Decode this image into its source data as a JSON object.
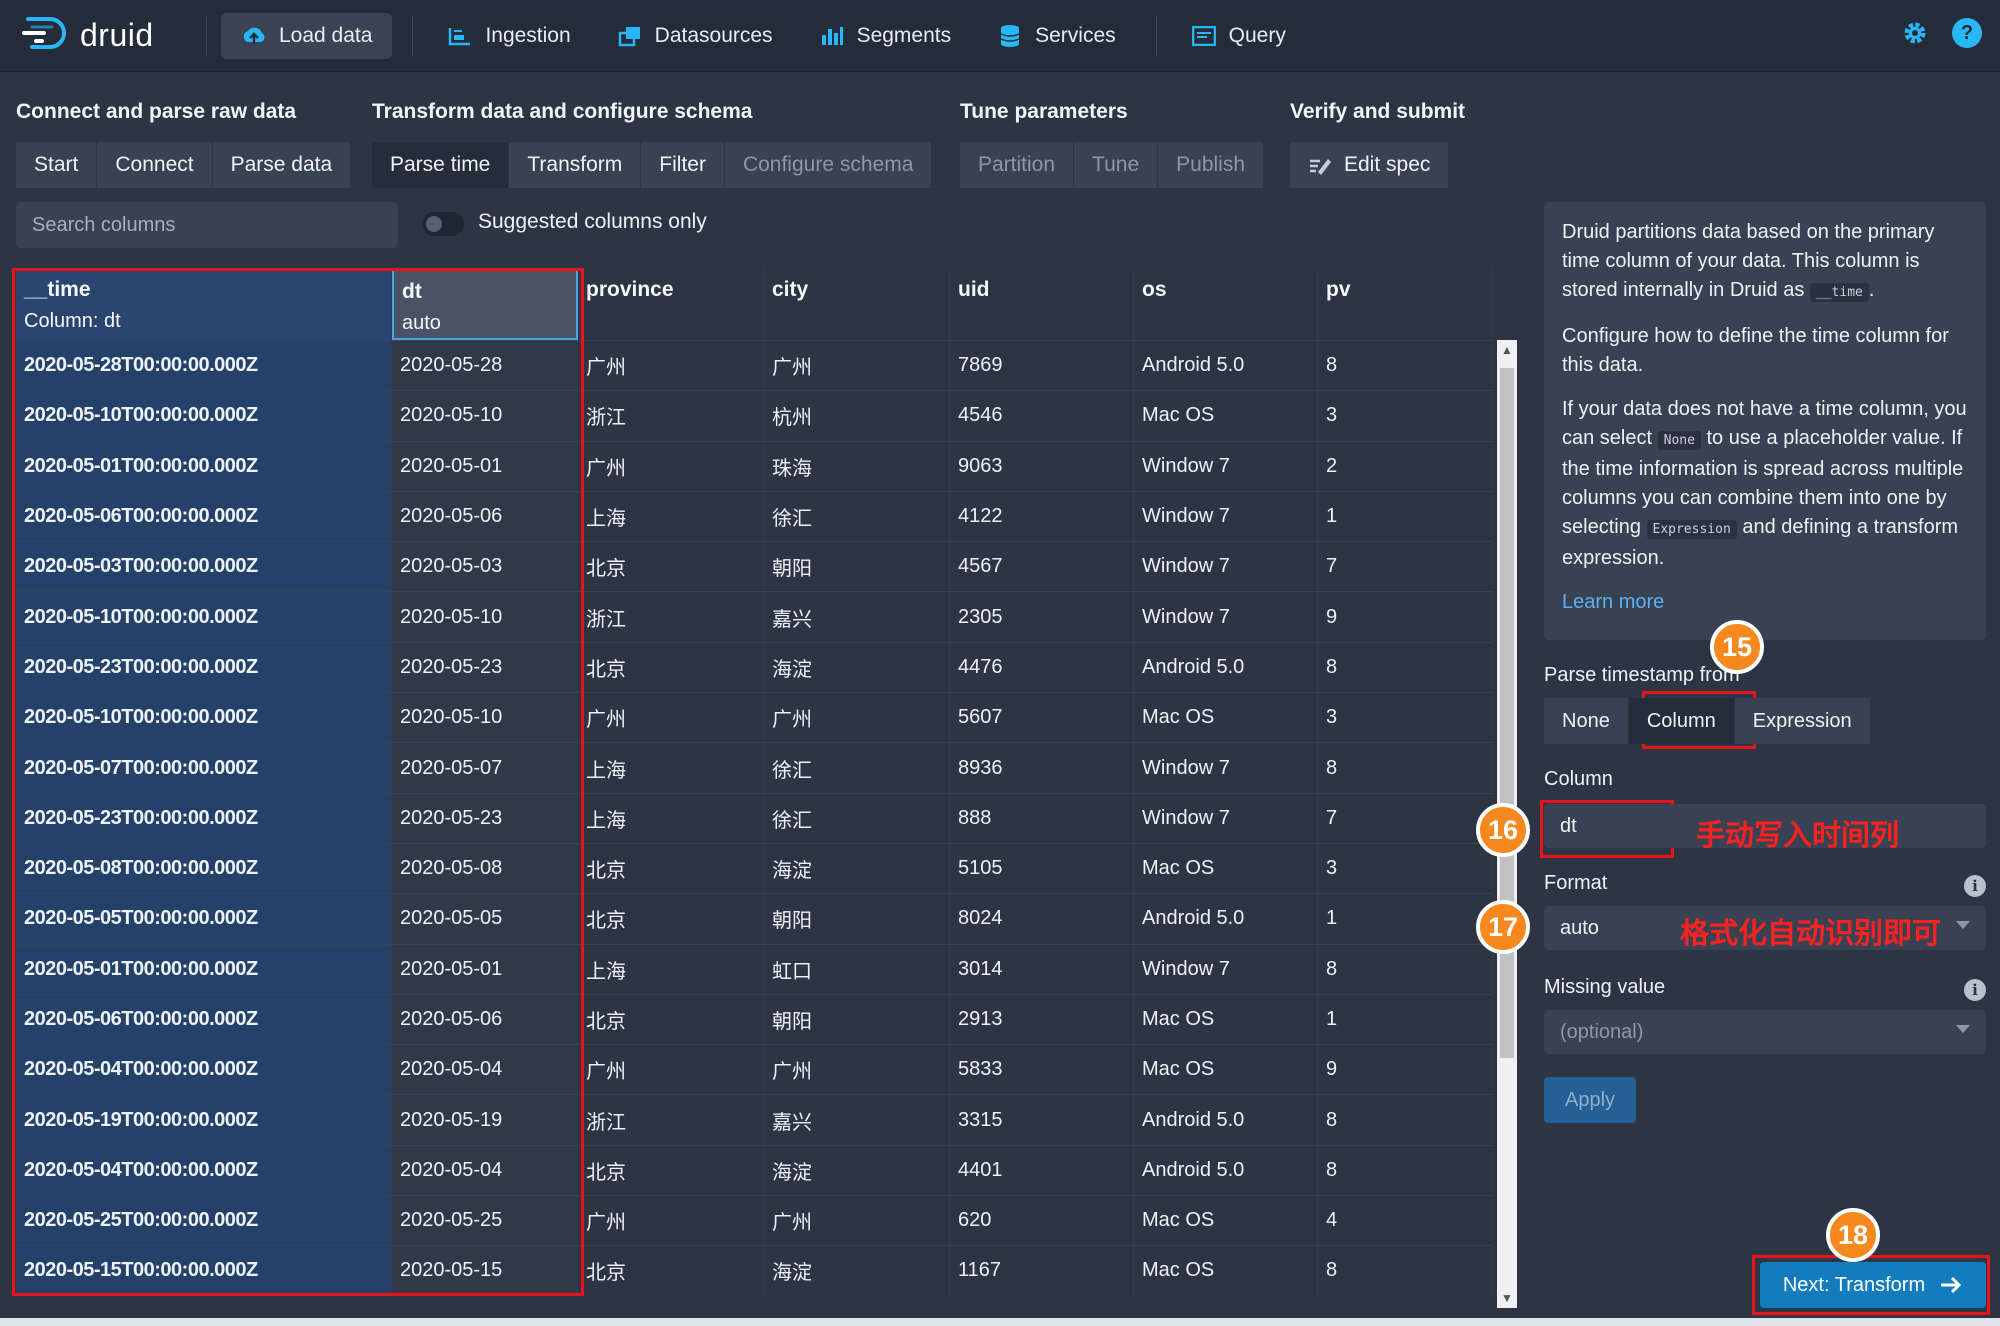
{
  "nav": {
    "logo": "druid",
    "items": [
      {
        "label": "Load data",
        "icon": "cloud-upload-icon",
        "active": true
      },
      {
        "label": "Ingestion",
        "icon": "ingestion-icon"
      },
      {
        "label": "Datasources",
        "icon": "datasources-icon"
      },
      {
        "label": "Segments",
        "icon": "segments-icon"
      },
      {
        "label": "Services",
        "icon": "database-icon"
      },
      {
        "label": "Query",
        "icon": "console-icon"
      }
    ],
    "right_icons": [
      "gear-icon",
      "help-icon"
    ]
  },
  "steps": {
    "groups": [
      {
        "title": "Connect and parse raw data",
        "buttons": [
          "Start",
          "Connect",
          "Parse data"
        ]
      },
      {
        "title": "Transform data and configure schema",
        "buttons": [
          "Parse time",
          "Transform",
          "Filter",
          "Configure schema"
        ]
      },
      {
        "title": "Tune parameters",
        "buttons": [
          "Partition",
          "Tune",
          "Publish"
        ]
      },
      {
        "title": "Verify and submit",
        "buttons": [
          "Edit spec"
        ]
      }
    ],
    "active": "Parse time"
  },
  "search": {
    "placeholder": "Search columns",
    "toggle_label": "Suggested columns only"
  },
  "table": {
    "columns": [
      {
        "name": "__time",
        "sub": "Column: dt"
      },
      {
        "name": "dt",
        "sub": "auto"
      },
      {
        "name": "province",
        "sub": ""
      },
      {
        "name": "city",
        "sub": ""
      },
      {
        "name": "uid",
        "sub": ""
      },
      {
        "name": "os",
        "sub": ""
      },
      {
        "name": "pv",
        "sub": ""
      }
    ],
    "rows": [
      [
        "2020-05-28T00:00:00.000Z",
        "2020-05-28",
        "广州",
        "广州",
        "7869",
        "Android 5.0",
        "8"
      ],
      [
        "2020-05-10T00:00:00.000Z",
        "2020-05-10",
        "浙江",
        "杭州",
        "4546",
        "Mac OS",
        "3"
      ],
      [
        "2020-05-01T00:00:00.000Z",
        "2020-05-01",
        "广州",
        "珠海",
        "9063",
        "Window 7",
        "2"
      ],
      [
        "2020-05-06T00:00:00.000Z",
        "2020-05-06",
        "上海",
        "徐汇",
        "4122",
        "Window 7",
        "1"
      ],
      [
        "2020-05-03T00:00:00.000Z",
        "2020-05-03",
        "北京",
        "朝阳",
        "4567",
        "Window 7",
        "7"
      ],
      [
        "2020-05-10T00:00:00.000Z",
        "2020-05-10",
        "浙江",
        "嘉兴",
        "2305",
        "Window 7",
        "9"
      ],
      [
        "2020-05-23T00:00:00.000Z",
        "2020-05-23",
        "北京",
        "海淀",
        "4476",
        "Android 5.0",
        "8"
      ],
      [
        "2020-05-10T00:00:00.000Z",
        "2020-05-10",
        "广州",
        "广州",
        "5607",
        "Mac OS",
        "3"
      ],
      [
        "2020-05-07T00:00:00.000Z",
        "2020-05-07",
        "上海",
        "徐汇",
        "8936",
        "Window 7",
        "8"
      ],
      [
        "2020-05-23T00:00:00.000Z",
        "2020-05-23",
        "上海",
        "徐汇",
        "888",
        "Window 7",
        "7"
      ],
      [
        "2020-05-08T00:00:00.000Z",
        "2020-05-08",
        "北京",
        "海淀",
        "5105",
        "Mac OS",
        "3"
      ],
      [
        "2020-05-05T00:00:00.000Z",
        "2020-05-05",
        "北京",
        "朝阳",
        "8024",
        "Android 5.0",
        "1"
      ],
      [
        "2020-05-01T00:00:00.000Z",
        "2020-05-01",
        "上海",
        "虹口",
        "3014",
        "Window 7",
        "8"
      ],
      [
        "2020-05-06T00:00:00.000Z",
        "2020-05-06",
        "北京",
        "朝阳",
        "2913",
        "Mac OS",
        "1"
      ],
      [
        "2020-05-04T00:00:00.000Z",
        "2020-05-04",
        "广州",
        "广州",
        "5833",
        "Mac OS",
        "9"
      ],
      [
        "2020-05-19T00:00:00.000Z",
        "2020-05-19",
        "浙江",
        "嘉兴",
        "3315",
        "Android 5.0",
        "8"
      ],
      [
        "2020-05-04T00:00:00.000Z",
        "2020-05-04",
        "北京",
        "海淀",
        "4401",
        "Android 5.0",
        "8"
      ],
      [
        "2020-05-25T00:00:00.000Z",
        "2020-05-25",
        "广州",
        "广州",
        "620",
        "Mac OS",
        "4"
      ],
      [
        "2020-05-15T00:00:00.000Z",
        "2020-05-15",
        "北京",
        "海淀",
        "1167",
        "Mac OS",
        "8"
      ]
    ]
  },
  "info": {
    "p1_a": "Druid partitions data based on the primary time column of your data. This column is stored internally in Druid as",
    "p1_code": "__time",
    "p1_b": ".",
    "p2": "Configure how to define the time column for this data.",
    "p3_a": "If your data does not have a time column, you can select",
    "p3_code1": "None",
    "p3_b": "to use a placeholder value. If the time information is spread across multiple columns you can combine them into one by selecting",
    "p3_code2": "Expression",
    "p3_c": "and defining a transform expression.",
    "learn_more": "Learn more"
  },
  "form": {
    "parse_label": "Parse timestamp from",
    "options": [
      "None",
      "Column",
      "Expression"
    ],
    "selected": "Column",
    "column_label": "Column",
    "column_value": "dt",
    "format_label": "Format",
    "format_value": "auto",
    "missing_label": "Missing value",
    "missing_placeholder": "(optional)",
    "apply": "Apply",
    "next": "Next: Transform"
  },
  "annotations": {
    "b15": "15",
    "b16": "16",
    "b17": "17",
    "b18": "18",
    "note16": "手动写入时间列",
    "note17": "格式化自动识别即可"
  },
  "colors": {
    "accent": "#137cbd",
    "highlight_red": "#e8131b",
    "badge_orange": "#f5891f"
  }
}
